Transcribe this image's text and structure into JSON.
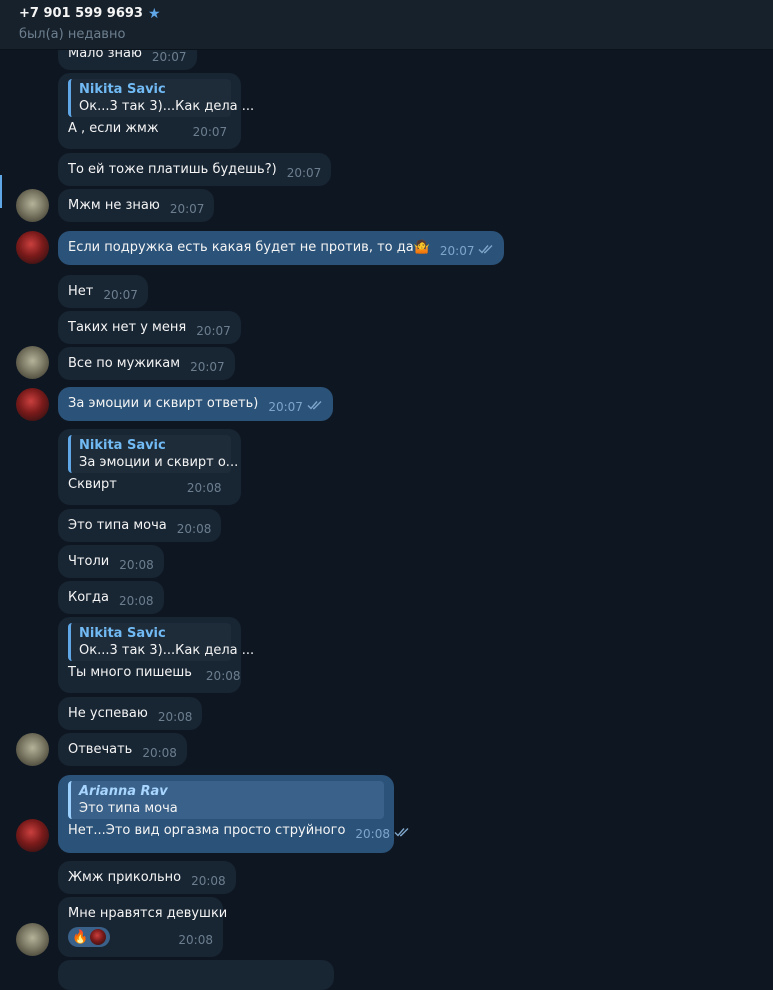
{
  "header": {
    "title": "+7 901 599 9693",
    "status": "был(а) недавно"
  },
  "messages": [
    {
      "text": "Мало знаю",
      "time": "20:07"
    },
    {
      "reply_name": "Nikita Savic",
      "reply_quote": "Ок...3 так 3)...Как дела ...",
      "text": "А , если жмж",
      "time": "20:07"
    },
    {
      "text": "То ей тоже платишь будешь?)",
      "time": "20:07"
    },
    {
      "text": "Мжм не знаю",
      "time": "20:07"
    },
    {
      "text": "Если подружка есть какая будет не против, то да",
      "emoji": "🤷",
      "time": "20:07"
    },
    {
      "text": "Нет",
      "time": "20:07"
    },
    {
      "text": "Таких нет у меня",
      "time": "20:07"
    },
    {
      "text": "Все по мужикам",
      "time": "20:07"
    },
    {
      "text": "За эмоции и сквирт ответь)",
      "time": "20:07"
    },
    {
      "reply_name": "Nikita Savic",
      "reply_quote": "За эмоции и сквирт о...",
      "text": "Сквирт",
      "time": "20:08"
    },
    {
      "text": "Это типа моча",
      "time": "20:08"
    },
    {
      "text": "Чтоли",
      "time": "20:08"
    },
    {
      "text": "Когда",
      "time": "20:08"
    },
    {
      "reply_name": "Nikita Savic",
      "reply_quote": "Ок...3 так 3)...Как дела ...",
      "text": "Ты много пишешь",
      "time": "20:08"
    },
    {
      "text": "Не успеваю",
      "time": "20:08"
    },
    {
      "text": "Отвечать",
      "time": "20:08"
    },
    {
      "reply_name": "Arianna Rav",
      "reply_quote": "Это типа моча",
      "text": "Нет...Это вид оргазма просто струйного",
      "time": "20:08"
    },
    {
      "text": "Жмж прикольно",
      "time": "20:08"
    },
    {
      "text": "Мне нравятся девушки",
      "time": "20:08",
      "reaction": "🔥"
    }
  ]
}
